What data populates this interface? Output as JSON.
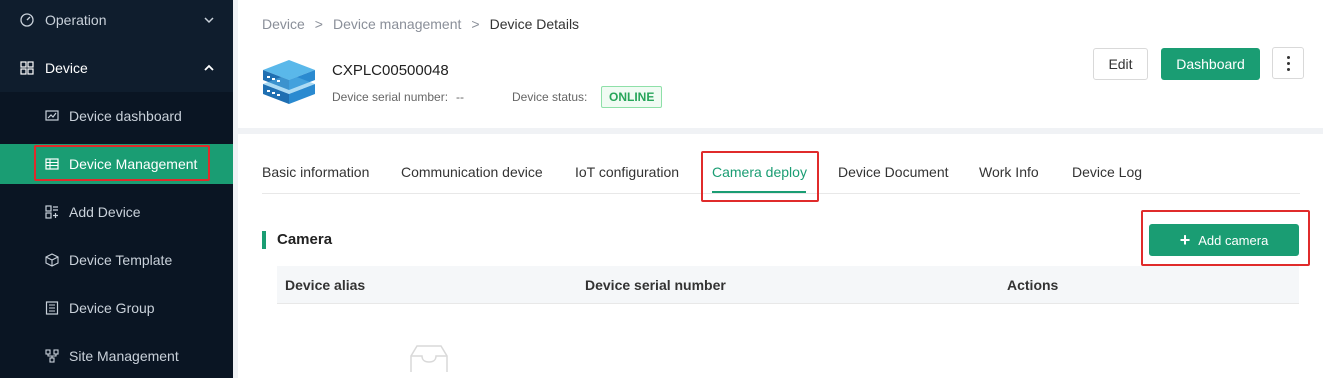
{
  "sidebar": {
    "groups": [
      {
        "label": "Operation"
      },
      {
        "label": "Device"
      }
    ],
    "items": [
      {
        "label": "Device dashboard"
      },
      {
        "label": "Device Management"
      },
      {
        "label": "Add Device"
      },
      {
        "label": "Device Template"
      },
      {
        "label": "Device Group"
      },
      {
        "label": "Site Management"
      }
    ]
  },
  "breadcrumb": {
    "items": [
      "Device",
      "Device management",
      "Device Details"
    ],
    "separator": ">"
  },
  "device": {
    "name": "CXPLC00500048",
    "serial_label": "Device serial number:",
    "serial_value": "--",
    "status_label": "Device status:",
    "status_value": "ONLINE"
  },
  "header_actions": {
    "edit": "Edit",
    "dashboard": "Dashboard"
  },
  "tabs": [
    {
      "label": "Basic information"
    },
    {
      "label": "Communication device"
    },
    {
      "label": "IoT configuration"
    },
    {
      "label": "Camera deploy"
    },
    {
      "label": "Device Document"
    },
    {
      "label": "Work Info"
    },
    {
      "label": "Device Log"
    }
  ],
  "camera_section": {
    "title": "Camera",
    "add_button": "Add camera",
    "columns": [
      "Device alias",
      "Device serial number",
      "Actions"
    ]
  },
  "colors": {
    "accent": "#1a9d73",
    "sidebar_bg": "#0f1d2d",
    "highlight": "#e02b2b"
  }
}
